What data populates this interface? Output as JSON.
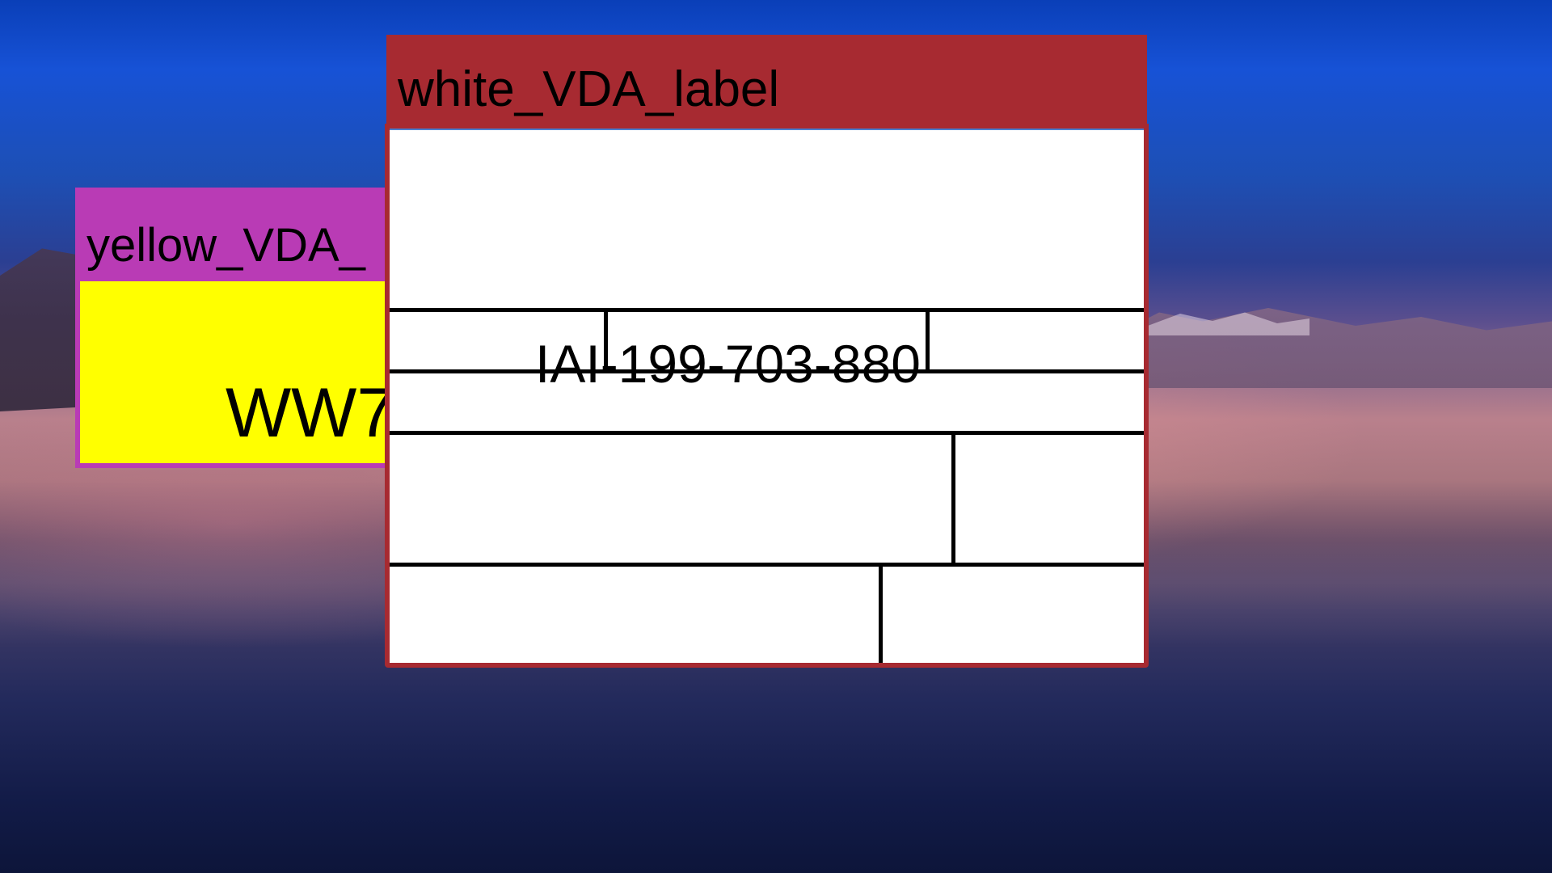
{
  "windows": {
    "yellow": {
      "title": "yellow_VDA_",
      "code": "WW7",
      "titlebar_color": "#b93bb5",
      "body_color": "#ffff00"
    },
    "white": {
      "title": "white_VDA_label",
      "id_text": "IAI-199-703-880",
      "titlebar_color": "#a72a31",
      "body_color": "#ffffff"
    }
  }
}
